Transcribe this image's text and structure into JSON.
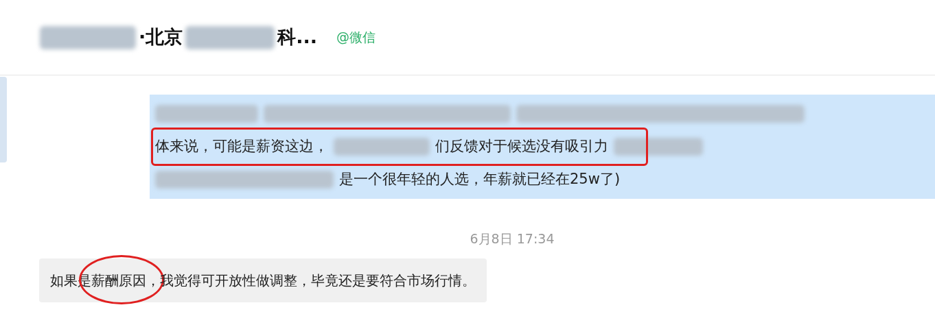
{
  "header": {
    "title": [
      {
        "kind": "redacted"
      },
      {
        "kind": "text",
        "text": "·北京"
      },
      {
        "kind": "redacted"
      },
      {
        "kind": "text",
        "text": "科..."
      }
    ],
    "source_tag": "@微信"
  },
  "outgoing": {
    "lines": [
      {
        "highlighted": false,
        "segments": [
          {
            "kind": "redacted"
          },
          {
            "kind": "redacted"
          },
          {
            "kind": "redacted"
          }
        ]
      },
      {
        "highlighted": true,
        "segments": [
          {
            "kind": "text",
            "text": "体来说，可能是薪资这边，"
          },
          {
            "kind": "redacted"
          },
          {
            "kind": "text",
            "text": "们反馈对于候选没有吸引力"
          },
          {
            "kind": "redacted"
          }
        ]
      },
      {
        "highlighted": false,
        "segments": [
          {
            "kind": "redacted"
          },
          {
            "kind": "text",
            "text": "是一个很年轻的人选，年薪就已经在25w了)"
          }
        ]
      }
    ]
  },
  "timestamp": "6月8日 17:34",
  "incoming": {
    "segments": [
      {
        "text": "如果是",
        "circled": false
      },
      {
        "text": "薪酬原因",
        "circled": true
      },
      {
        "text": "，我觉得可开放性做调整，毕竟还是要符合市场行情。",
        "circled": false
      }
    ]
  }
}
